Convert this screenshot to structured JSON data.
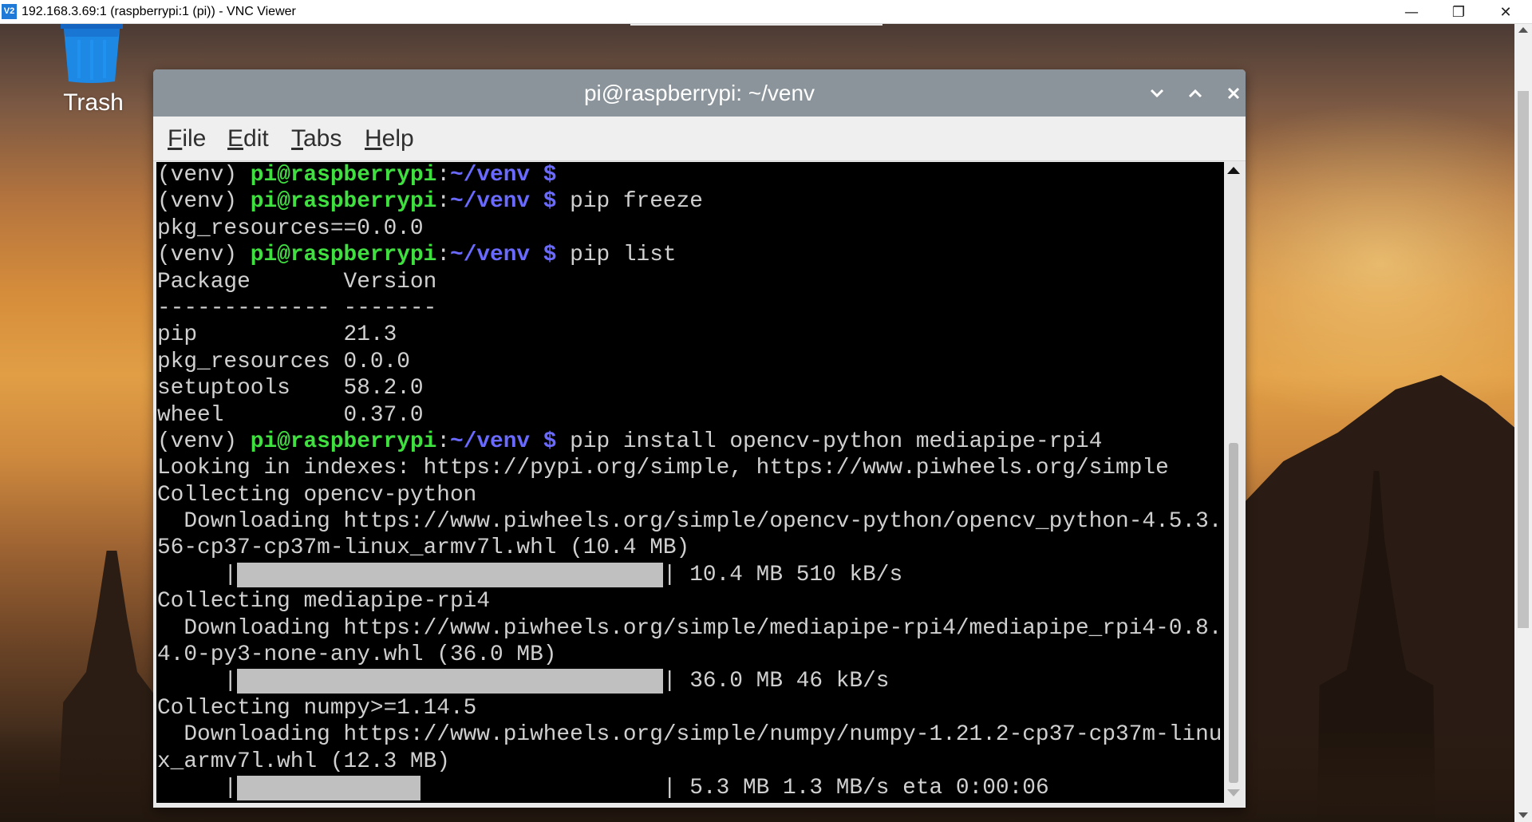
{
  "vnc": {
    "logo_text": "V2",
    "title": "192.168.3.69:1 (raspberrypi:1 (pi)) - VNC Viewer",
    "min_glyph": "—",
    "restore_glyph": "❐",
    "close_glyph": "✕"
  },
  "desktop": {
    "trash_label": "Trash"
  },
  "terminal": {
    "title": "pi@raspberrypi: ~/venv",
    "menu": {
      "file_u": "F",
      "file_rest": "ile",
      "edit_u": "E",
      "edit_rest": "dit",
      "tabs_u": "T",
      "tabs_rest": "abs",
      "help_u": "H",
      "help_rest": "elp"
    },
    "prompt": {
      "venv": "(venv) ",
      "user_host": "pi@raspberrypi",
      "colon": ":",
      "path_dollar": "~/venv $"
    },
    "commands": {
      "c1": "",
      "c2": " pip freeze",
      "c3": " pip list",
      "c4": " pip install opencv-python mediapipe-rpi4"
    },
    "output": {
      "freeze_out": "pkg_resources==0.0.0",
      "list_header": "Package       Version",
      "list_sep": "------------- -------",
      "pkg1": "pip           21.3",
      "pkg2": "pkg_resources 0.0.0",
      "pkg3": "setuptools    58.2.0",
      "pkg4": "wheel         0.37.0",
      "looking": "Looking in indexes: https://pypi.org/simple, https://www.piwheels.org/simple",
      "collect1": "Collecting opencv-python",
      "dl1a": "  Downloading https://www.piwheels.org/simple/opencv-python/opencv_python-4.5.3.",
      "dl1b": "56-cp37-cp37m-linux_armv7l.whl (10.4 MB)",
      "bar1_left": "     |",
      "bar1_right": "                                | 10.4 MB 510 kB/s",
      "collect2": "Collecting mediapipe-rpi4",
      "dl2a": "  Downloading https://www.piwheels.org/simple/mediapipe-rpi4/mediapipe_rpi4-0.8.",
      "dl2b": "4.0-py3-none-any.whl (36.0 MB)",
      "bar2_left": "     |",
      "bar2_right": "                                | 36.0 MB 46 kB/s",
      "collect3": "Collecting numpy>=1.14.5",
      "dl3a": "  Downloading https://www.piwheels.org/simple/numpy/numpy-1.21.2-cp37-cp37m-linu",
      "dl3b": "x_armv7l.whl (12.3 MB)",
      "bar3_left": "     |",
      "bar3_right": "                                | 5.3 MB 1.3 MB/s eta 0:00:06"
    },
    "progress": {
      "bar1_fraction": 1.0,
      "bar2_fraction": 1.0,
      "bar3_fraction": 0.43
    }
  },
  "colors": {
    "prompt_user": "#3fe03f",
    "prompt_path": "#6a6aff",
    "terminal_bg": "#000000",
    "titlebar": "#8a949a"
  }
}
